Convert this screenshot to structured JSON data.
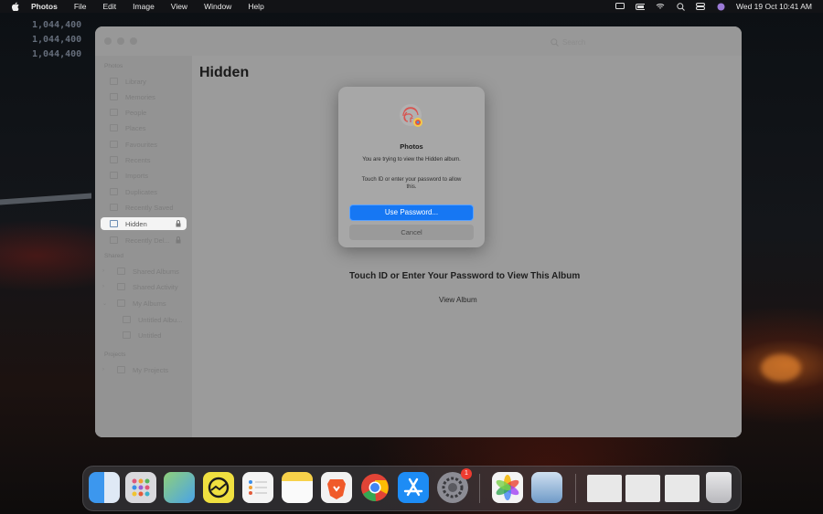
{
  "menubar": {
    "app_name": "Photos",
    "items": [
      "File",
      "Edit",
      "Image",
      "View",
      "Window",
      "Help"
    ],
    "datetime": "Wed 19 Oct  10:41 AM"
  },
  "wallpaper": {
    "big_numbers": [
      "1,044,400",
      "1,044,400",
      "1,044,400"
    ]
  },
  "window": {
    "search_placeholder": "Search",
    "sidebar": {
      "sections": [
        "Photos",
        "Shared",
        "Projects"
      ],
      "library_items": [
        {
          "label": "Library",
          "icon": "library-icon"
        },
        {
          "label": "Memories",
          "icon": "memories-icon"
        },
        {
          "label": "People",
          "icon": "people-icon"
        },
        {
          "label": "Places",
          "icon": "places-icon"
        },
        {
          "label": "Favourites",
          "icon": "heart-icon"
        },
        {
          "label": "Recents",
          "icon": "clock-icon"
        },
        {
          "label": "Imports",
          "icon": "import-icon"
        },
        {
          "label": "Duplicates",
          "icon": "duplicates-icon"
        },
        {
          "label": "Recently Saved",
          "icon": "saved-icon"
        },
        {
          "label": "Hidden",
          "icon": "hidden-icon",
          "selected": true,
          "locked": true
        },
        {
          "label": "Recently Del...",
          "icon": "trash-icon",
          "locked": true
        }
      ],
      "shared_items": [
        {
          "label": "Shared Albums",
          "icon": "shared-albums-icon"
        },
        {
          "label": "Shared Activity",
          "icon": "activity-icon"
        }
      ],
      "my_albums": [
        {
          "label": "My Albums",
          "icon": "album-folder-icon"
        },
        {
          "label": "Untitled Albu...",
          "icon": "album-icon"
        },
        {
          "label": "Untitled",
          "icon": "album-icon"
        }
      ],
      "project_items": [
        {
          "label": "My Projects",
          "icon": "projects-icon"
        }
      ]
    },
    "main": {
      "title": "Hidden",
      "locked_message": "Touch ID or Enter Your Password to View This Album",
      "view_album": "View Album"
    }
  },
  "dialog": {
    "title": "Photos",
    "message": "You are trying to view the Hidden album.",
    "sub": "Touch ID or enter your password to allow this.",
    "primary_button": "Use Password...",
    "cancel_button": "Cancel"
  },
  "dock": {
    "apps": [
      {
        "name": "Finder",
        "color": "#4aa3f0"
      },
      {
        "name": "Launchpad",
        "color": "#d9d9dd"
      },
      {
        "name": "Maps",
        "color": "#6cc56b"
      },
      {
        "name": "Basecamp",
        "color": "#f0e040"
      },
      {
        "name": "Reminders",
        "color": "#f2f2f2"
      },
      {
        "name": "Notes",
        "color": "#f7d14a"
      },
      {
        "name": "Brave",
        "color": "#f05a2a"
      },
      {
        "name": "Chrome",
        "color": "#e8e8e8"
      },
      {
        "name": "App Store",
        "color": "#1d8cf5"
      },
      {
        "name": "System Preferences",
        "color": "#8c8c94",
        "badge": "1"
      },
      {
        "name": "Photos",
        "color": "#f4f4f4"
      },
      {
        "name": "Preview",
        "color": "#6f9ac8"
      }
    ]
  }
}
